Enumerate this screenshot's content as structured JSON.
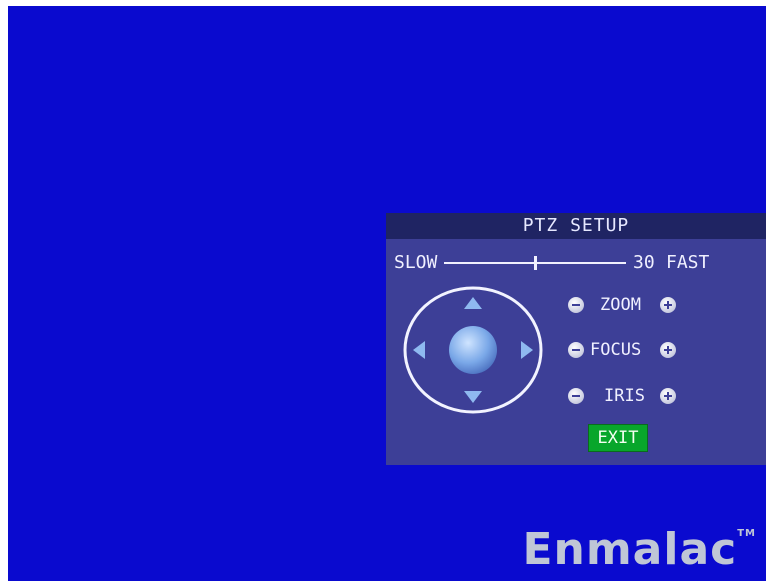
{
  "panel": {
    "title": "PTZ SETUP",
    "speed": {
      "slow_label": "SLOW",
      "value": "30",
      "fast_label": "FAST",
      "level": 0.5
    },
    "controls": [
      {
        "label": "ZOOM"
      },
      {
        "label": "FOCUS"
      },
      {
        "label": "IRIS"
      }
    ],
    "exit_label": "EXIT"
  },
  "branding": {
    "logo_text": "Enmalac",
    "trademark": "TM"
  },
  "colors": {
    "screen_bg": "#0a0acf",
    "panel_bg": "#3d3f97",
    "title_bar": "#1f2463",
    "exit_button": "#08a62b",
    "dpad_accent": "#8fb9f0"
  },
  "icons": [
    "arrow-up-icon",
    "arrow-down-icon",
    "arrow-left-icon",
    "arrow-right-icon",
    "minus-icon",
    "plus-icon"
  ]
}
